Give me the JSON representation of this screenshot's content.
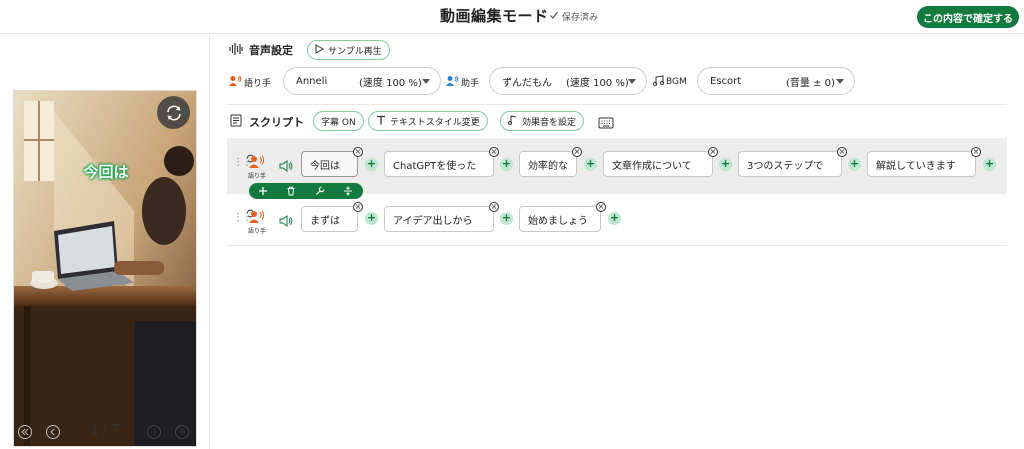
{
  "header": {
    "title": "動画編集モード",
    "saved_status": "保存済み",
    "confirm_label": "この内容で確定する"
  },
  "preview": {
    "caption": "今回は",
    "current_page": 1,
    "total_pages": 7,
    "page_text": "1 / 7"
  },
  "voice": {
    "section_title": "音声設定",
    "sample_label": "サンプル再生",
    "narrator_label": "語り手",
    "narrator_name": "Anneli",
    "narrator_speed": "(速度 100 %)",
    "assistant_label": "助手",
    "assistant_name": "ずんだもん",
    "assistant_speed": "(速度 100 %)",
    "bgm_label": "BGM",
    "bgm_name": "Escort",
    "bgm_volume": "(音量 ± 0)"
  },
  "script": {
    "section_title": "スクリプト",
    "subtitle_toggle": "字幕 ON",
    "text_style_label": "テキストスタイル変更",
    "sound_effect_label": "効果音を設定",
    "rows": [
      {
        "speaker": "語り手",
        "chunks": [
          "今回は",
          "ChatGPTを使った",
          "効率的な",
          "文章作成について",
          "3つのステップで",
          "解説していきます"
        ]
      },
      {
        "speaker": "語り手",
        "chunks": [
          "まずは",
          "アイデア出しから",
          "始めましょう"
        ]
      }
    ]
  },
  "colors": {
    "accent": "#127a3e",
    "plus_bg": "#bfe6d0",
    "pill_border": "#7dcfa0",
    "speaker_icon": "#e8621c"
  }
}
